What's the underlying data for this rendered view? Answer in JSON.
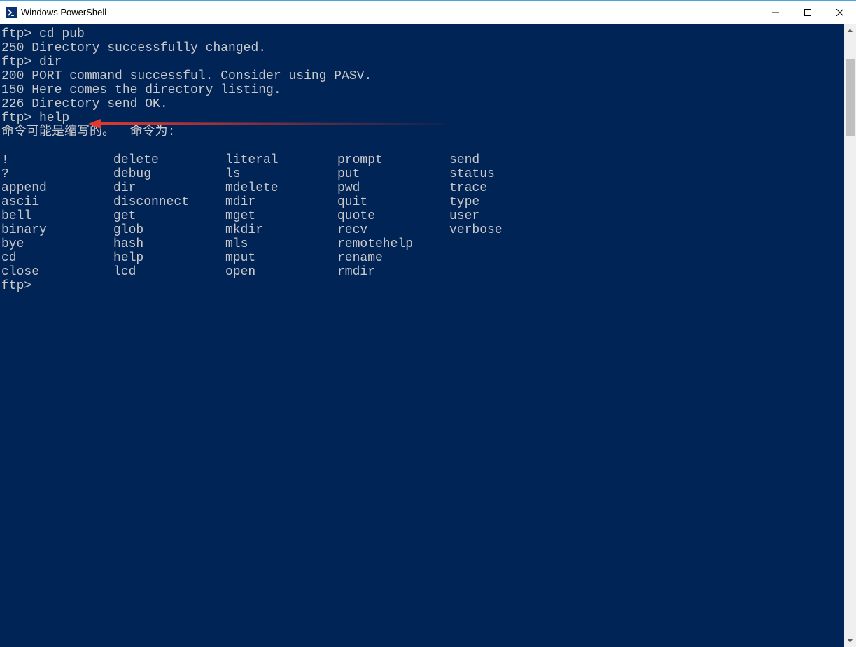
{
  "window": {
    "title": "Windows PowerShell"
  },
  "terminal": {
    "prompt": "ftp>",
    "entries": [
      {
        "prompt": "ftp>",
        "cmd": "cd pub"
      },
      {
        "response": "250 Directory successfully changed."
      },
      {
        "prompt": "ftp>",
        "cmd": "dir"
      },
      {
        "response": "200 PORT command successful. Consider using PASV."
      },
      {
        "response": "150 Here comes the directory listing."
      },
      {
        "response": "226 Directory send OK."
      },
      {
        "prompt": "ftp>",
        "cmd": "help"
      },
      {
        "response": "命令可能是缩写的。  命令为:"
      }
    ],
    "help_columns": [
      [
        "!",
        "?",
        "append",
        "ascii",
        "bell",
        "binary",
        "bye",
        "cd",
        "close"
      ],
      [
        "delete",
        "debug",
        "dir",
        "disconnect",
        "get",
        "glob",
        "hash",
        "help",
        "lcd"
      ],
      [
        "literal",
        "ls",
        "mdelete",
        "mdir",
        "mget",
        "mkdir",
        "mls",
        "mput",
        "open"
      ],
      [
        "prompt",
        "put",
        "pwd",
        "quit",
        "quote",
        "recv",
        "remotehelp",
        "rename",
        "rmdir"
      ],
      [
        "send",
        "status",
        "trace",
        "type",
        "user",
        "verbose",
        "",
        "",
        ""
      ]
    ],
    "final_prompt": "ftp>"
  }
}
